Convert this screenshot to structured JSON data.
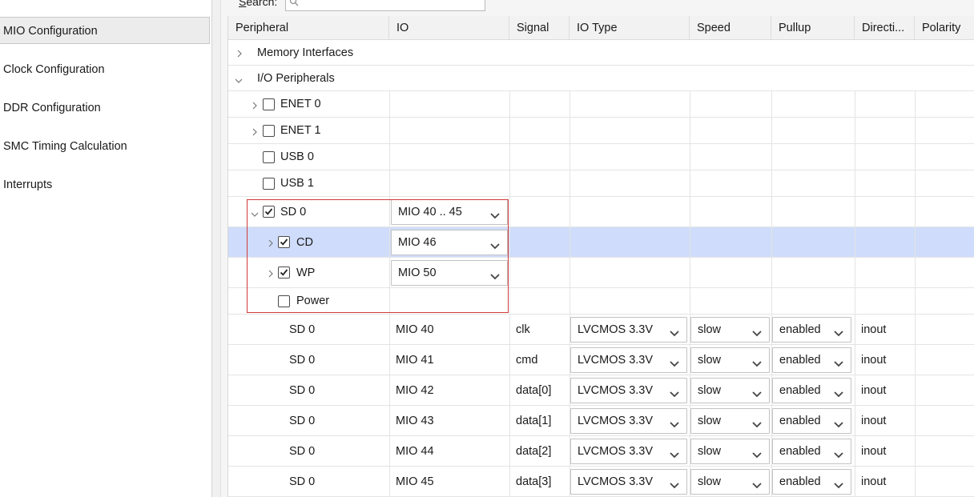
{
  "sidebar": {
    "items": [
      {
        "label": "MIO Configuration"
      },
      {
        "label": "Clock Configuration"
      },
      {
        "label": "DDR Configuration"
      },
      {
        "label": "SMC Timing Calculation"
      },
      {
        "label": "Interrupts"
      }
    ]
  },
  "search": {
    "label_first": "S",
    "label_rest": "earch:"
  },
  "table": {
    "columns": [
      "Peripheral",
      "IO",
      "Signal",
      "IO Type",
      "Speed",
      "Pullup",
      "Directi...",
      "Polarity"
    ],
    "groups": {
      "memory": "Memory Interfaces",
      "io": "I/O Peripherals"
    },
    "peripherals": [
      {
        "name": "ENET 0",
        "checked": false
      },
      {
        "name": "ENET 1",
        "checked": false
      },
      {
        "name": "USB 0",
        "checked": false
      },
      {
        "name": "USB 1",
        "checked": false
      }
    ],
    "sd0": {
      "name": "SD 0",
      "io": "MIO 40 .. 45",
      "checked": true
    },
    "cd": {
      "name": "CD",
      "io": "MIO 46",
      "checked": true
    },
    "wp": {
      "name": "WP",
      "io": "MIO 50",
      "checked": true
    },
    "power": {
      "name": "Power",
      "checked": false
    },
    "pins": [
      {
        "peripheral": "SD 0",
        "io": "MIO 40",
        "signal": "clk",
        "io_type": "LVCMOS 3.3V",
        "speed": "slow",
        "pullup": "enabled",
        "direction": "inout"
      },
      {
        "peripheral": "SD 0",
        "io": "MIO 41",
        "signal": "cmd",
        "io_type": "LVCMOS 3.3V",
        "speed": "slow",
        "pullup": "enabled",
        "direction": "inout"
      },
      {
        "peripheral": "SD 0",
        "io": "MIO 42",
        "signal": "data[0]",
        "io_type": "LVCMOS 3.3V",
        "speed": "slow",
        "pullup": "enabled",
        "direction": "inout"
      },
      {
        "peripheral": "SD 0",
        "io": "MIO 43",
        "signal": "data[1]",
        "io_type": "LVCMOS 3.3V",
        "speed": "slow",
        "pullup": "enabled",
        "direction": "inout"
      },
      {
        "peripheral": "SD 0",
        "io": "MIO 44",
        "signal": "data[2]",
        "io_type": "LVCMOS 3.3V",
        "speed": "slow",
        "pullup": "enabled",
        "direction": "inout"
      },
      {
        "peripheral": "SD 0",
        "io": "MIO 45",
        "signal": "data[3]",
        "io_type": "LVCMOS 3.3V",
        "speed": "slow",
        "pullup": "enabled",
        "direction": "inout"
      }
    ]
  },
  "colors": {
    "selection": "#cfdcfb",
    "highlight_border": "#d23a3a"
  }
}
